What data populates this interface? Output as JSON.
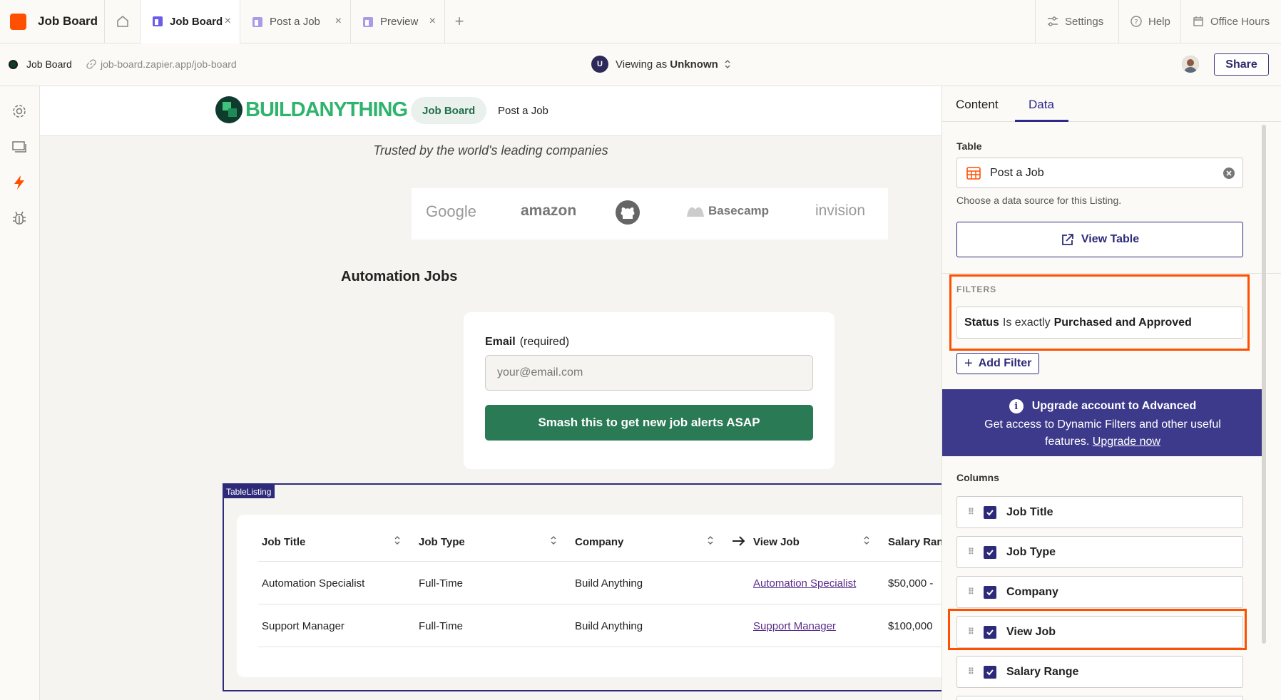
{
  "app": {
    "name": "Job Board",
    "tabs": [
      {
        "label": "Job Board",
        "active": true
      },
      {
        "label": "Post a Job",
        "active": false
      },
      {
        "label": "Preview",
        "active": false
      }
    ],
    "right_buttons": {
      "settings": "Settings",
      "help": "Help",
      "office_hours": "Office Hours"
    }
  },
  "subbar": {
    "site_name": "Job Board",
    "url": "job-board.zapier.app/job-board",
    "viewing_prefix": "Viewing as",
    "viewing_user": "Unknown",
    "viewing_badge": "U",
    "share_label": "Share"
  },
  "site": {
    "logo_text": "BUILDANYTHING",
    "nav": [
      {
        "label": "Job Board",
        "active": true
      },
      {
        "label": "Post a Job",
        "active": false
      }
    ],
    "tagline": "Trusted by the world's leading companies",
    "companies": [
      "Google",
      "amazon",
      "Basecamp",
      "invision"
    ],
    "jobs_heading": "Automation Jobs",
    "email_label": "Email",
    "email_required": "(required)",
    "email_placeholder": "your@email.com",
    "cta_label": "Smash this to get new job alerts ASAP",
    "component_tag": "TableListing",
    "table": {
      "headers": [
        "Job Title",
        "Job Type",
        "Company",
        "View Job",
        "Salary Ran"
      ],
      "rows": [
        [
          "Automation Specialist",
          "Full-Time",
          "Build Anything",
          "Automation Specialist",
          "$50,000 -"
        ],
        [
          "Support Manager",
          "Full-Time",
          "Build Anything",
          "Support Manager",
          "$100,000"
        ]
      ]
    }
  },
  "panel": {
    "tabs": [
      "Content",
      "Data"
    ],
    "active_tab": "Data",
    "table_label": "Table",
    "table_value": "Post a Job",
    "table_help": "Choose a data source for this Listing.",
    "view_table_label": "View Table",
    "filters_label": "FILTERS",
    "filter": {
      "field": "Status",
      "operator": "Is exactly",
      "value": "Purchased and Approved"
    },
    "add_filter_label": "Add Filter",
    "upgrade": {
      "title": "Upgrade account to Advanced",
      "body": "Get access to Dynamic Filters and other useful features.",
      "link": "Upgrade now"
    },
    "columns_label": "Columns",
    "columns": [
      {
        "label": "Job Title",
        "checked": true
      },
      {
        "label": "Job Type",
        "checked": true
      },
      {
        "label": "Company",
        "checked": true
      },
      {
        "label": "View Job",
        "checked": true
      },
      {
        "label": "Salary Range",
        "checked": true
      }
    ]
  },
  "colors": {
    "accent": "#2d2a7a",
    "highlight": "#ff4f00",
    "brand_green": "#2fb36d",
    "cta_green": "#2a7a55",
    "zapier_orange": "#ff4f00"
  }
}
